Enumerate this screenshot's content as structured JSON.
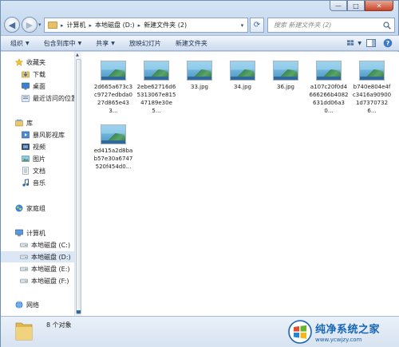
{
  "window": {
    "controls": {
      "minimize": "—",
      "maximize": "□",
      "close": "✕"
    }
  },
  "address_bar": {
    "breadcrumbs": [
      "计算机",
      "本地磁盘 (D:)",
      "新建文件夹 (2)"
    ],
    "separator": "▸"
  },
  "search": {
    "placeholder": "搜索 新建文件夹 (2)"
  },
  "toolbar": {
    "organize": "组织",
    "include_in_library": "包含到库中",
    "share": "共享",
    "slideshow": "放映幻灯片",
    "new_folder": "新建文件夹"
  },
  "sidebar": {
    "favorites": {
      "header": "收藏夹",
      "items": [
        "下载",
        "桌面",
        "最近访问的位置"
      ]
    },
    "libraries": {
      "header": "库",
      "items": [
        "暴风影视库",
        "视频",
        "图片",
        "文档",
        "音乐"
      ]
    },
    "homegroup": {
      "header": "家庭组"
    },
    "computer": {
      "header": "计算机",
      "items": [
        "本地磁盘 (C:)",
        "本地磁盘 (D:)",
        "本地磁盘 (E:)",
        "本地磁盘 (F:)"
      ],
      "selected_index": 1
    },
    "network": {
      "header": "网络"
    }
  },
  "files": [
    {
      "name": "2d665a673c3c9727edbda027d865e433...",
      "icon": "image-file-icon"
    },
    {
      "name": "2ebe62716d65313067e81547189e30e5...",
      "icon": "image-file-icon"
    },
    {
      "name": "33.jpg",
      "icon": "image-file-icon"
    },
    {
      "name": "34.jpg",
      "icon": "image-file-icon"
    },
    {
      "name": "36.jpg",
      "icon": "image-file-icon"
    },
    {
      "name": "a107c20f0d4666266b4082631dd06a30...",
      "icon": "image-file-icon"
    },
    {
      "name": "b740e804e4fc3416a909001d73707326...",
      "icon": "image-file-icon"
    },
    {
      "name": "ed415a2d8bab57e30a6747520f454d0...",
      "icon": "image-file-icon"
    }
  ],
  "status_bar": {
    "count_text": "8 个对象"
  },
  "watermark": {
    "title": "纯净系统之家",
    "url": "www.ycwjzy.com"
  },
  "colors": {
    "accent": "#1565b6",
    "toolbar_text": "#1e3150",
    "selected_row": "#dbe7f5",
    "folder": "#e6c169"
  }
}
